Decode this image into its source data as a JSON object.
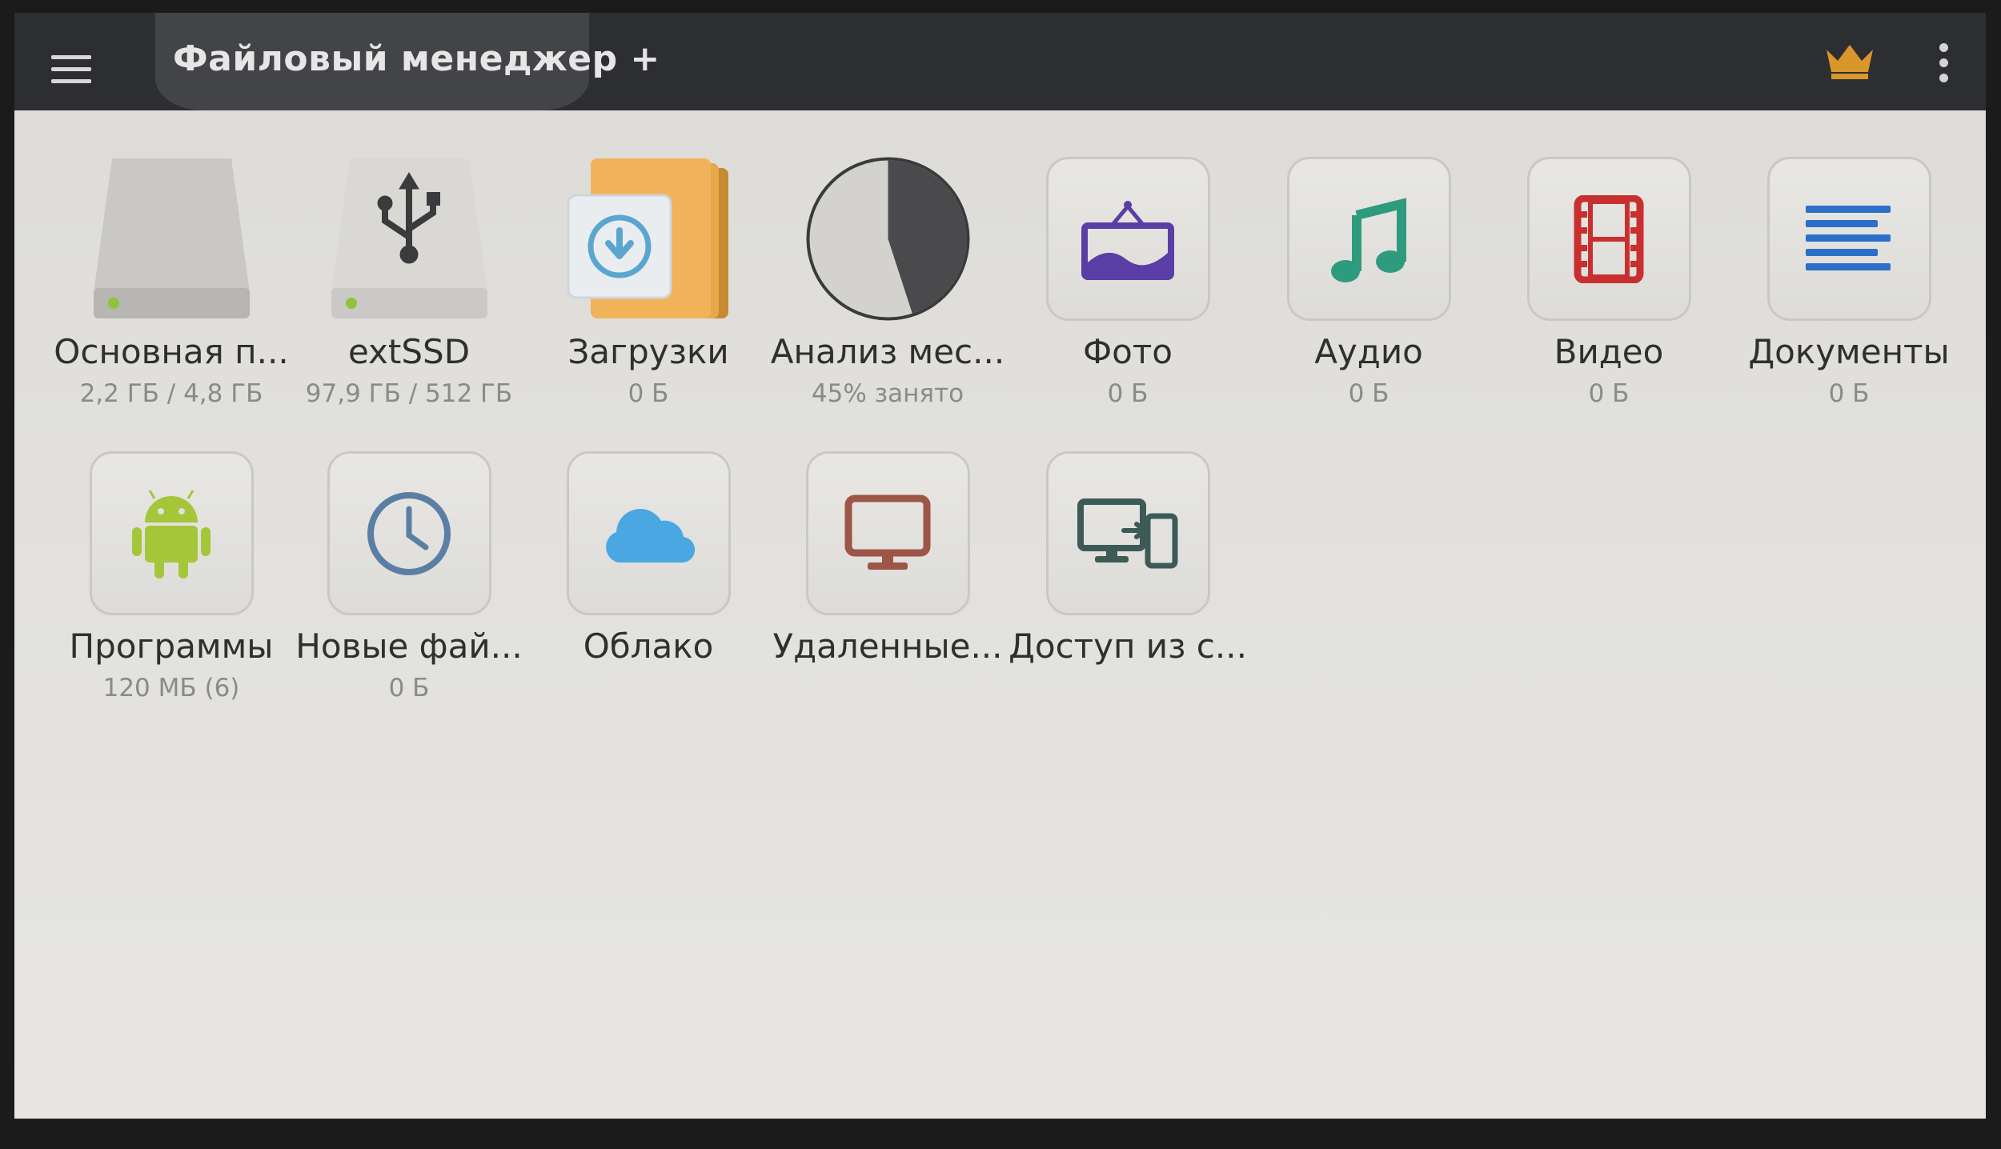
{
  "appbar": {
    "title": "Файловый менеджер +",
    "menu_icon": "hamburger-menu-icon",
    "premium_icon": "crown-icon",
    "more_icon": "more-vertical-icon",
    "crown_color": "#d9962a"
  },
  "tiles_row1": [
    {
      "label": "Основная п...",
      "sub": "2,2 ГБ / 4,8 ГБ",
      "icon": "internal-storage-icon"
    },
    {
      "label": "extSSD",
      "sub": "97,9 ГБ / 512 ГБ",
      "icon": "usb-storage-icon"
    },
    {
      "label": "Загрузки",
      "sub": "0 Б",
      "icon": "downloads-folder-icon"
    },
    {
      "label": "Анализ мес...",
      "sub": "45% занято",
      "icon": "storage-analysis-pie-icon",
      "used_fraction": 0.45
    },
    {
      "label": "Фото",
      "sub": "0 Б",
      "icon": "photo-icon",
      "color": "#5b3ea5"
    },
    {
      "label": "Аудио",
      "sub": "0 Б",
      "icon": "music-note-icon",
      "color": "#2e9b7e"
    },
    {
      "label": "Видео",
      "sub": "0 Б",
      "icon": "film-icon",
      "color": "#c8302f"
    },
    {
      "label": "Документы",
      "sub": "0 Б",
      "icon": "document-lines-icon",
      "color": "#2c6fc9"
    }
  ],
  "tiles_row2": [
    {
      "label": "Программы",
      "sub": "120 МБ (6)",
      "icon": "android-icon",
      "color": "#a4c639"
    },
    {
      "label": "Новые фай...",
      "sub": "0 Б",
      "icon": "clock-icon",
      "color": "#5a7fa3"
    },
    {
      "label": "Облако",
      "sub": "",
      "icon": "cloud-icon",
      "color": "#4aa7e2"
    },
    {
      "label": "Удаленные...",
      "sub": "",
      "icon": "monitor-icon",
      "color": "#9c5546"
    },
    {
      "label": "Доступ из с...",
      "sub": "",
      "icon": "remote-access-devices-icon",
      "color": "#3d5a57"
    }
  ]
}
